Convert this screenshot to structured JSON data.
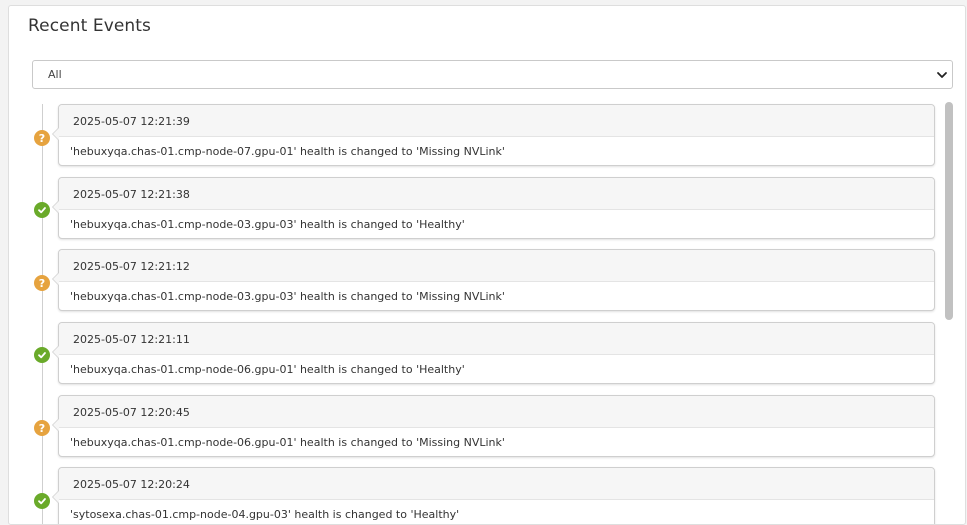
{
  "panel": {
    "title": "Recent Events"
  },
  "filter": {
    "selected": "All"
  },
  "events": [
    {
      "time": "2025-05-07 12:21:39",
      "message": "'hebuxyqa.chas-01.cmp-node-07.gpu-01' health is changed to 'Missing NVLink'",
      "status": "warning",
      "icon": "question-icon"
    },
    {
      "time": "2025-05-07 12:21:38",
      "message": "'hebuxyqa.chas-01.cmp-node-03.gpu-03' health is changed to 'Healthy'",
      "status": "ok",
      "icon": "check-icon"
    },
    {
      "time": "2025-05-07 12:21:12",
      "message": "'hebuxyqa.chas-01.cmp-node-03.gpu-03' health is changed to 'Missing NVLink'",
      "status": "warning",
      "icon": "question-icon"
    },
    {
      "time": "2025-05-07 12:21:11",
      "message": "'hebuxyqa.chas-01.cmp-node-06.gpu-01' health is changed to 'Healthy'",
      "status": "ok",
      "icon": "check-icon"
    },
    {
      "time": "2025-05-07 12:20:45",
      "message": "'hebuxyqa.chas-01.cmp-node-06.gpu-01' health is changed to 'Missing NVLink'",
      "status": "warning",
      "icon": "question-icon"
    },
    {
      "time": "2025-05-07 12:20:24",
      "message": "'sytosexa.chas-01.cmp-node-04.gpu-03' health is changed to 'Healthy'",
      "status": "ok",
      "icon": "check-icon"
    }
  ],
  "colors": {
    "warning": "#e6a33f",
    "ok": "#6aaa2a"
  }
}
